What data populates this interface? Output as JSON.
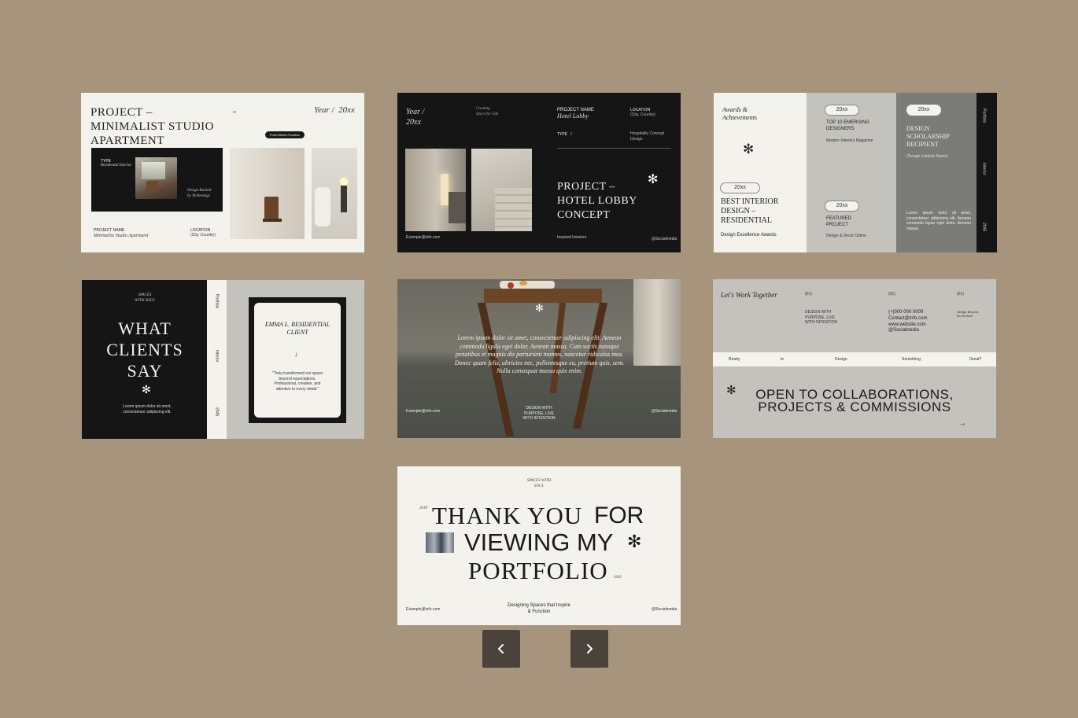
{
  "slide1": {
    "title": "PROJECT – MINIMALIST STUDIO APARTMENT",
    "arrow": "→",
    "year": "Year /  20xx",
    "badge": "Form Meets Function",
    "type_label": "TYPE",
    "type_value": "Residential Interior",
    "tagline": "Design Backed by Technology",
    "project_name_label": "PROJECT NAME",
    "project_name_value": "Minimalist Studio Apartment",
    "location_label": "LOCATION",
    "location_value": "(City, Country)"
  },
  "slide2": {
    "year": "Year / 20xx",
    "creating": "Creating Space for Life",
    "project_name_label": "PROJECT NAME",
    "project_name_value": "Hotel Lobby",
    "location_label": "LOCATION",
    "location_value": "(City, Country)",
    "type_label": "TYPE   /",
    "type_value": "Hospitality Concept Design",
    "title": "PROJECT – HOTEL LOBBY CONCEPT",
    "email": "Example@info.com",
    "inspired": "Inspired Interiors",
    "social": "@Socialmedia",
    "star": "✻"
  },
  "slide3": {
    "heading": "Awards & Achievements",
    "star": "✻",
    "award1_year": "20xx",
    "award1_title": "BEST INTERIOR DESIGN – RESIDENTIAL",
    "award1_org": "Design Excellence Awards",
    "award2_year": "20xx",
    "award2_title": "TOP 10 EMERGING DESIGNERS",
    "award2_org": "Modern Interiors Magazine",
    "award3_year": "20xx",
    "award3_title": "FEATURED PROJECT",
    "award3_org": "Design & Decor Online",
    "award4_year": "20xx",
    "award4_title": "DESIGN SCHOLARSHIP RECIPIENT",
    "award4_org": "(Design Institute Name)",
    "lorem": "Lorem ipsum dolor sit amet, consectetuer adipiscing elit. Aenean commodo ligula eget dolor. Aenean massa.",
    "side": [
      "Portfolio",
      "Interior",
      "2045"
    ]
  },
  "slide4": {
    "tag": "SPACES WITH SOUL",
    "title": "WHAT CLIENTS SAY",
    "star": "✻",
    "lorem": "Lorem ipsum dolor sit amet, consectetuer adipiscing elit.",
    "side": [
      "Portfolio",
      "Interior",
      "2045"
    ],
    "client": "EMMA L. RESIDENTIAL CLIENT",
    "down_arrow": "↓",
    "quote": "\"Truly transformed our space beyond expectations. Professional, creative, and attentive to every detail.\""
  },
  "slide5": {
    "star": "✻",
    "lorem": "Lorem ipsum dolor sit amet, consectetuer adipiscing elit. Aenean commodo ligula eget dolor. Aenean massa. Cum sociis natoque penatibus et magnis dis parturient montes, nascetur ridiculus mus. Donec quam felis, ultricies nec, pellentesque eu, pretium quis, sem. Nulla consequat massa quis enim.",
    "email": "Example@info.com",
    "center": "DESIGN WITH PURPOSE, LIVE WITH INTENTION",
    "social": "@Socialmedia"
  },
  "slide6": {
    "heading": "Let's Work Together",
    "n1": "(01)",
    "n2": "(01)",
    "n3": "(01)",
    "purpose": "DESIGN WITH PURPOSE, LIVE WITH INTENTION",
    "contact": [
      "(+)000 000 0000",
      "Contact@info.com",
      "www.website.com",
      "@Socialmedia"
    ],
    "beyond": "Design Beyond the Surface",
    "strip": [
      "Ready",
      "to",
      "Design",
      "Something",
      "Great?"
    ],
    "star": "✻",
    "headline1": "OPEN TO COLLABORATIONS,",
    "headline2": "PROJECTS & COMMISSIONS",
    "arrow": "→"
  },
  "slide7": {
    "tag": "SPACES WITH SOUL",
    "year_left": "2018",
    "line1a": "THANK YOU",
    "line1b": "FOR",
    "line2": "VIEWING MY",
    "star": "✻",
    "line3": "PORTFOLIO",
    "year_right": "2045",
    "email": "Example@info.com",
    "center": "Designing Spaces that Inspire & Function",
    "social": "@Socialmedia"
  },
  "nav": {
    "prev_icon": "chevron-left-icon",
    "next_icon": "chevron-right-icon"
  },
  "colors": {
    "background": "#a6947c",
    "cream": "#f4f2ed",
    "dark": "#151515",
    "grey": "#c4c2bd",
    "darkgrey": "#7b7b78",
    "nav": "#4b433b"
  }
}
